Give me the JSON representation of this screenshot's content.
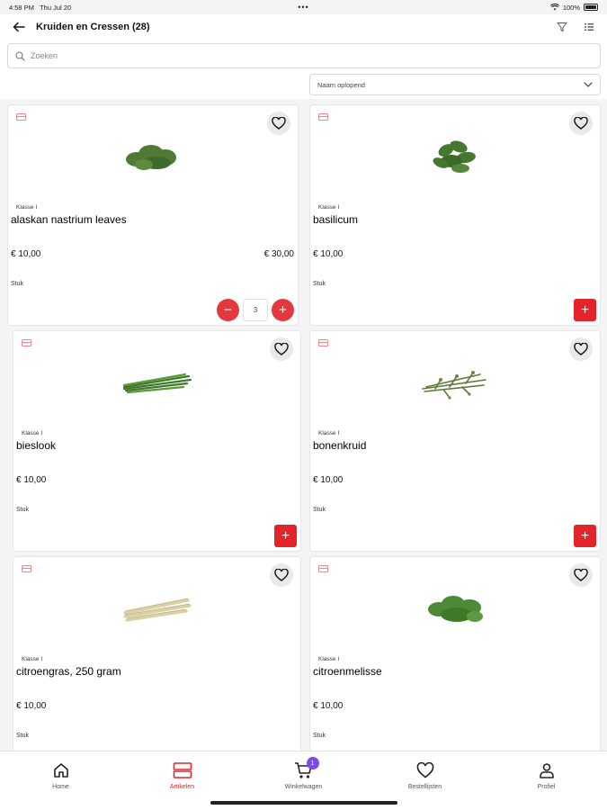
{
  "status": {
    "time": "4:58 PM",
    "date": "Thu Jul 20",
    "battery": "100%"
  },
  "header": {
    "title": "Kruiden en Cressen (28)"
  },
  "search": {
    "placeholder": "Zoeken"
  },
  "sort": {
    "label": "Naam oplopend"
  },
  "products": [
    {
      "klasse": "Klasse I",
      "name": "alaskan nastrium leaves",
      "price": "€ 10,00",
      "price_total": "€ 30,00",
      "unit": "Stuk",
      "quantity": "3"
    },
    {
      "klasse": "Klasse I",
      "name": "basilicum",
      "price": "€ 10,00",
      "unit": "Stuk"
    },
    {
      "klasse": "Klasse I",
      "name": "bieslook",
      "price": "€ 10,00",
      "unit": "Stuk"
    },
    {
      "klasse": "Klasse I",
      "name": "bonenkruid",
      "price": "€ 10,00",
      "unit": "Stuk"
    },
    {
      "klasse": "Klasse I",
      "name": "citroengras, 250 gram",
      "price": "€ 10,00",
      "unit": "Stuk"
    },
    {
      "klasse": "Klasse I",
      "name": "citroenmelisse",
      "price": "€ 10,00",
      "unit": "Stuk"
    }
  ],
  "nav": {
    "items": [
      {
        "label": "Home",
        "icon": "home-icon"
      },
      {
        "label": "Artikelen",
        "icon": "articles-icon"
      },
      {
        "label": "Winkelwagen",
        "icon": "cart-icon",
        "badge": "1"
      },
      {
        "label": "Bestellijsten",
        "icon": "heart-icon"
      },
      {
        "label": "Profiel",
        "icon": "profile-icon"
      }
    ]
  },
  "colors": {
    "accent": "#e3242b",
    "badge": "#7b4ce8"
  }
}
